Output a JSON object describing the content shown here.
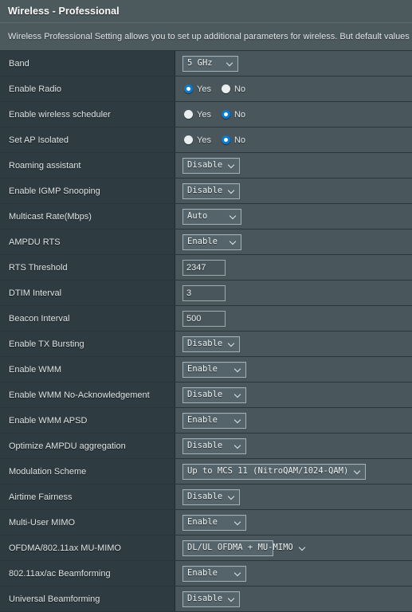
{
  "header": {
    "title": "Wireless - Professional"
  },
  "description": "Wireless Professional Setting allows you to set up additional parameters for wireless. But default values are",
  "colors": {
    "accent_blue": "#0a7ad1",
    "panel_bg": "#49575c",
    "label_bg": "#2e3b41",
    "header_bg": "#4c5a5e",
    "border": "#2b3438"
  },
  "rows": [
    {
      "label": "Band",
      "type": "select",
      "value": "5 GHz",
      "width": "w-short"
    },
    {
      "label": "Enable Radio",
      "type": "radio",
      "options": [
        "Yes",
        "No"
      ],
      "selected": "Yes"
    },
    {
      "label": "Enable wireless scheduler",
      "type": "radio",
      "options": [
        "Yes",
        "No"
      ],
      "selected": "No"
    },
    {
      "label": "Set AP Isolated",
      "type": "radio",
      "options": [
        "Yes",
        "No"
      ],
      "selected": "No"
    },
    {
      "label": "Roaming assistant",
      "type": "select",
      "value": "Disable",
      "width": "w-med"
    },
    {
      "label": "Enable IGMP Snooping",
      "type": "select",
      "value": "Disable",
      "width": "w-med"
    },
    {
      "label": "Multicast Rate(Mbps)",
      "type": "select",
      "value": "Auto",
      "width": "w-auto"
    },
    {
      "label": "AMPDU RTS",
      "type": "select",
      "value": "Enable",
      "width": "w-auto"
    },
    {
      "label": "RTS Threshold",
      "type": "input",
      "value": "2347"
    },
    {
      "label": "DTIM Interval",
      "type": "input",
      "value": "3"
    },
    {
      "label": "Beacon Interval",
      "type": "input",
      "value": "500"
    },
    {
      "label": "Enable TX Bursting",
      "type": "select",
      "value": "Disable",
      "width": "w-med"
    },
    {
      "label": "Enable WMM",
      "type": "select",
      "value": "Enable",
      "width": "w-wide"
    },
    {
      "label": "Enable WMM No-Acknowledgement",
      "type": "select",
      "value": "Disable",
      "width": "w-wide"
    },
    {
      "label": "Enable WMM APSD",
      "type": "select",
      "value": "Enable",
      "width": "w-wide"
    },
    {
      "label": "Optimize AMPDU aggregation",
      "type": "select",
      "value": "Disable",
      "width": "w-wide"
    },
    {
      "label": "Modulation Scheme",
      "type": "select",
      "value": "Up to MCS 11 (NitroQAM/1024-QAM)",
      "width": "w-xxwide"
    },
    {
      "label": "Airtime Fairness",
      "type": "select",
      "value": "Disable",
      "width": "w-med"
    },
    {
      "label": "Multi-User MIMO",
      "type": "select",
      "value": "Enable",
      "width": "w-wide"
    },
    {
      "label": "OFDMA/802.11ax MU-MIMO",
      "type": "select",
      "value": "DL/UL OFDMA + MU-MIMO",
      "width": "w-xwide"
    },
    {
      "label": "802.11ax/ac Beamforming",
      "type": "select",
      "value": "Enable",
      "width": "w-wide"
    },
    {
      "label": "Universal Beamforming",
      "type": "select",
      "value": "Disable",
      "width": "w-med"
    }
  ]
}
